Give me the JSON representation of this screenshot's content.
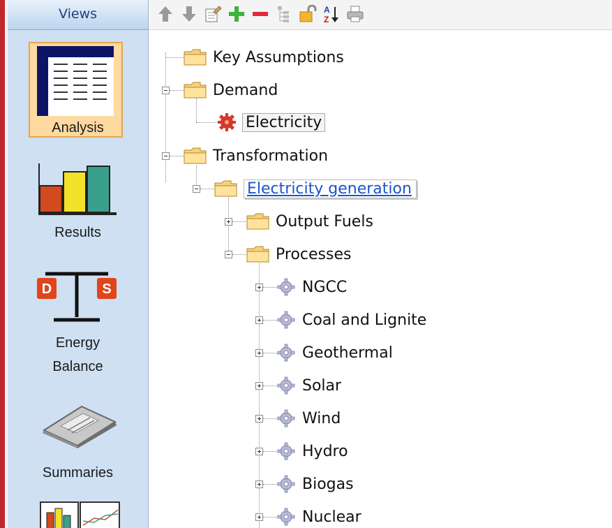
{
  "views_panel": {
    "header": "Views",
    "items": [
      {
        "label": "Analysis",
        "icon": "analysis-icon",
        "selected": true
      },
      {
        "label": "Results",
        "icon": "results-icon"
      },
      {
        "label_line1": "Energy",
        "label_line2": "Balance",
        "icon": "energy-balance-icon"
      },
      {
        "label": "Summaries",
        "icon": "summaries-icon"
      },
      {
        "label": "",
        "icon": "overviews-icon"
      }
    ]
  },
  "toolbar": {
    "buttons": [
      "up-arrow-icon",
      "down-arrow-icon",
      "properties-icon",
      "add-icon",
      "delete-icon",
      "outline-icon",
      "lock-icon",
      "sort-az-icon",
      "print-icon"
    ]
  },
  "tree": {
    "key_assumptions": "Key Assumptions",
    "demand": "Demand",
    "electricity": "Electricity",
    "transformation": "Transformation",
    "electricity_generation": "Electricity generation",
    "output_fuels": "Output Fuels",
    "processes": "Processes",
    "process_items": [
      "NGCC",
      "Coal and Lignite",
      "Geothermal",
      "Solar",
      "Wind",
      "Hydro",
      "Biogas",
      "Nuclear"
    ]
  },
  "colors": {
    "sidebar_bg": "#cfe0f3",
    "selected_bg": "#fed9a0",
    "link": "#1a55cc",
    "frame_red": "#c0282d"
  }
}
